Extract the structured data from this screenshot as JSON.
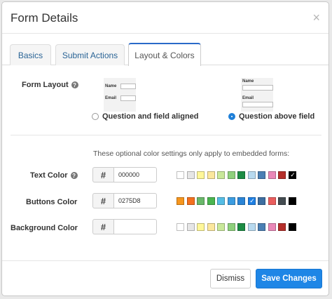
{
  "modal": {
    "title": "Form Details",
    "close_symbol": "×"
  },
  "tabs": [
    {
      "label": "Basics",
      "active": false
    },
    {
      "label": "Submit Actions",
      "active": false
    },
    {
      "label": "Layout & Colors",
      "active": true
    }
  ],
  "layout": {
    "label": "Form Layout",
    "help_symbol": "?",
    "options": [
      {
        "label": "Question and field aligned",
        "selected": false,
        "thumb_labels": [
          "Name",
          "Email"
        ]
      },
      {
        "label": "Question above field",
        "selected": true,
        "thumb_labels": [
          "Name",
          "Email"
        ]
      }
    ]
  },
  "colors": {
    "note": "These optional color settings only apply to embedded forms:",
    "hash_symbol": "#",
    "rows": [
      {
        "label": "Text Color",
        "help": "?",
        "value": "000000",
        "selected_index": 11,
        "palette": [
          "#ffffff",
          "#e6e6e6",
          "#fff799",
          "#fbe79d",
          "#c9e89a",
          "#8ed07c",
          "#1c8c44",
          "#b7d9ef",
          "#4a7fb4",
          "#ea88b8",
          "#b52f2a",
          "#000000"
        ]
      },
      {
        "label": "Buttons Color",
        "help": "",
        "value": "0275D8",
        "selected_index": 7,
        "palette": [
          "#f6961e",
          "#f4701e",
          "#6ab86a",
          "#4ab54f",
          "#55bde5",
          "#3b9ce1",
          "#2a84d6",
          "#1e7fe3",
          "#3d6ea0",
          "#ea5e5e",
          "#444c51",
          "#000000"
        ]
      },
      {
        "label": "Background Color",
        "help": "",
        "value": "",
        "selected_index": -1,
        "palette": [
          "#ffffff",
          "#e6e6e6",
          "#fff799",
          "#fbe79d",
          "#c9e89a",
          "#8ed07c",
          "#1c8c44",
          "#b7d9ef",
          "#4a7fb4",
          "#ea88b8",
          "#b52f2a",
          "#000000"
        ]
      }
    ],
    "check_symbol": "✓"
  },
  "footer": {
    "dismiss_label": "Dismiss",
    "save_label": "Save Changes"
  }
}
